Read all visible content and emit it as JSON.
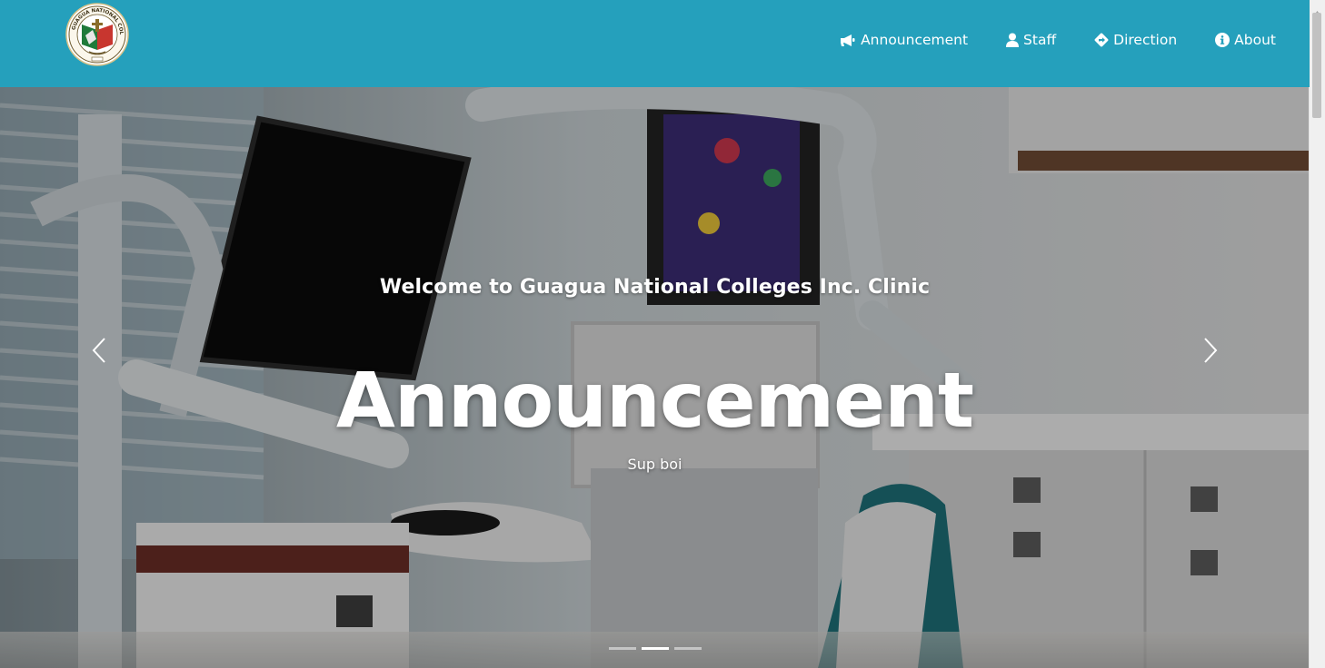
{
  "navbar": {
    "logo_alt": "Guagua National Colleges Inc. logo",
    "items": [
      {
        "label": "Announcement",
        "icon": "bullhorn-icon"
      },
      {
        "label": "Staff",
        "icon": "user-icon"
      },
      {
        "label": "Direction",
        "icon": "direction-sign-icon"
      },
      {
        "label": "About",
        "icon": "info-circle-icon"
      }
    ]
  },
  "hero": {
    "welcome": "Welcome to Guagua National Colleges Inc. Clinic",
    "headline": "Announcement",
    "subtext": "Sup boi",
    "prev_icon": "chevron-left-icon",
    "next_icon": "chevron-right-icon",
    "slides": 3,
    "active_slide": 2
  },
  "colors": {
    "navbar": "#25a0bc",
    "text": "#ffffff"
  }
}
